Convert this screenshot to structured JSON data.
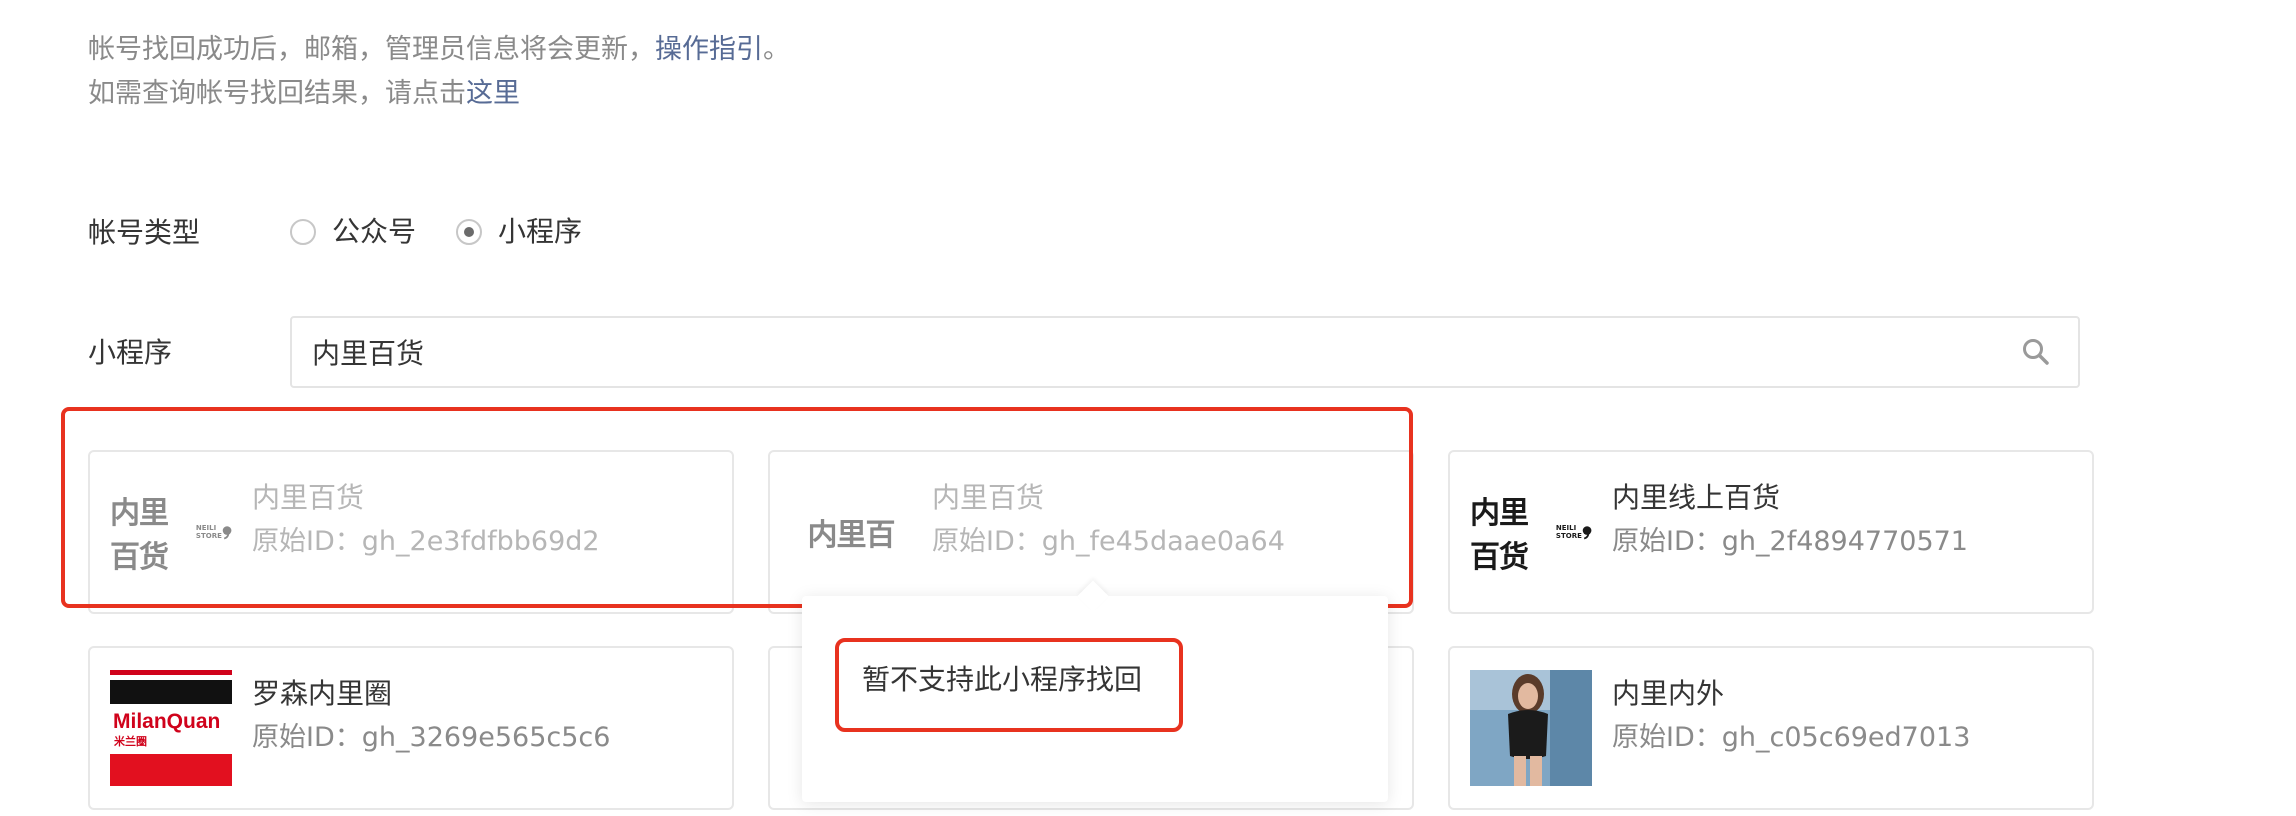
{
  "notice": {
    "line1_text": "帐号找回成功后，邮箱，管理员信息将会更新，",
    "line1_link": "操作指引",
    "line1_end": "。",
    "line2_text": "如需查询帐号找回结果，请点击",
    "line2_link": "这里"
  },
  "form": {
    "account_type_label": "帐号类型",
    "radio_options": [
      {
        "label": "公众号",
        "checked": false
      },
      {
        "label": "小程序",
        "checked": true
      }
    ],
    "miniprogram_label": "小程序",
    "search_value": "内里百货"
  },
  "results": [
    {
      "name": "内里百货",
      "id_label": "原始ID：",
      "id": "gh_2e3fdfbb69d2",
      "logo": "neili-store-logo",
      "logo_text": "内里百货",
      "disabled": true
    },
    {
      "name": "内里百货",
      "id_label": "原始ID：",
      "id": "gh_fe45daae0a64",
      "logo": "neili-logo",
      "logo_text": "内里百",
      "disabled": true
    },
    {
      "name": "内里线上百货",
      "id_label": "原始ID：",
      "id": "gh_2f4894770571",
      "logo": "neili-store-logo",
      "logo_text": "内里百货",
      "disabled": false
    },
    {
      "name": "罗森内里圈",
      "id_label": "原始ID：",
      "id": "gh_3269e565c5c6",
      "logo": "milanquan-logo",
      "logo_text": "MilanQuan",
      "logo_subtext": "米兰圈",
      "disabled": false
    },
    {
      "name": "",
      "id_label": "",
      "id": "",
      "logo": "circle-logo",
      "disabled": false
    },
    {
      "name": "内里内外",
      "id_label": "原始ID：",
      "id": "gh_c05c69ed7013",
      "logo": "model-photo",
      "disabled": false
    }
  ],
  "tooltip": {
    "text": "暂不支持此小程序找回"
  },
  "colors": {
    "link": "#576b95",
    "highlight_red": "#e8321f",
    "muted_text": "#8a8a8a"
  }
}
